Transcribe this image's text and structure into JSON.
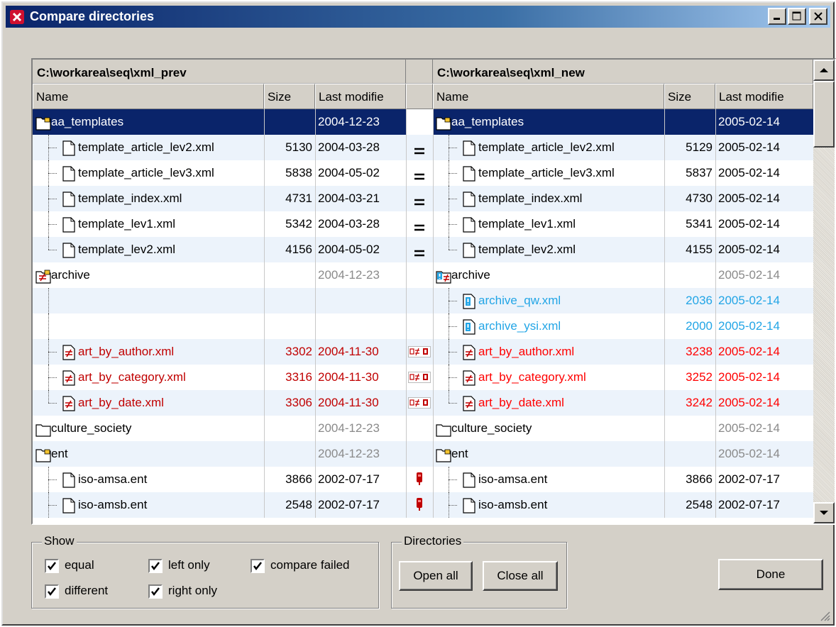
{
  "window": {
    "title": "Compare directories"
  },
  "left": {
    "path": "C:\\workarea\\seq\\xml_prev",
    "col_name": "Name",
    "col_size": "Size",
    "col_date": "Last modifie"
  },
  "right": {
    "path": "C:\\workarea\\seq\\xml_new",
    "col_name": "Name",
    "col_size": "Size",
    "col_date": "Last modifie"
  },
  "rows": [
    {
      "lname": "aa_templates",
      "lsize": "",
      "ldate": "2004-12-23",
      "mid": "",
      "rname": "aa_templates",
      "rsize": "",
      "rdate": "2005-02-14"
    },
    {
      "lname": "template_article_lev2.xml",
      "lsize": "5130",
      "ldate": "2004-03-28",
      "mid": "=",
      "rname": "template_article_lev2.xml",
      "rsize": "5129",
      "rdate": "2005-02-14"
    },
    {
      "lname": "template_article_lev3.xml",
      "lsize": "5838",
      "ldate": "2004-05-02",
      "mid": "=",
      "rname": "template_article_lev3.xml",
      "rsize": "5837",
      "rdate": "2005-02-14"
    },
    {
      "lname": "template_index.xml",
      "lsize": "4731",
      "ldate": "2004-03-21",
      "mid": "=",
      "rname": "template_index.xml",
      "rsize": "4730",
      "rdate": "2005-02-14"
    },
    {
      "lname": "template_lev1.xml",
      "lsize": "5342",
      "ldate": "2004-03-28",
      "mid": "=",
      "rname": "template_lev1.xml",
      "rsize": "5341",
      "rdate": "2005-02-14"
    },
    {
      "lname": "template_lev2.xml",
      "lsize": "4156",
      "ldate": "2004-05-02",
      "mid": "=",
      "rname": "template_lev2.xml",
      "rsize": "4155",
      "rdate": "2005-02-14"
    },
    {
      "lname": "archive",
      "lsize": "",
      "ldate": "2004-12-23",
      "mid": "",
      "rname": "archive",
      "rsize": "",
      "rdate": "2005-02-14"
    },
    {
      "lname": "",
      "lsize": "",
      "ldate": "",
      "mid": "",
      "rname": "archive_qw.xml",
      "rsize": "2036",
      "rdate": "2005-02-14"
    },
    {
      "lname": "",
      "lsize": "",
      "ldate": "",
      "mid": "",
      "rname": "archive_ysi.xml",
      "rsize": "2000",
      "rdate": "2005-02-14"
    },
    {
      "lname": "art_by_author.xml",
      "lsize": "3302",
      "ldate": "2004-11-30",
      "mid": "",
      "rname": "art_by_author.xml",
      "rsize": "3238",
      "rdate": "2005-02-14"
    },
    {
      "lname": "art_by_category.xml",
      "lsize": "3316",
      "ldate": "2004-11-30",
      "mid": "",
      "rname": "art_by_category.xml",
      "rsize": "3252",
      "rdate": "2005-02-14"
    },
    {
      "lname": "art_by_date.xml",
      "lsize": "3306",
      "ldate": "2004-11-30",
      "mid": "",
      "rname": "art_by_date.xml",
      "rsize": "3242",
      "rdate": "2005-02-14"
    },
    {
      "lname": "culture_society",
      "lsize": "",
      "ldate": "2004-12-23",
      "mid": "",
      "rname": "culture_society",
      "rsize": "",
      "rdate": "2005-02-14"
    },
    {
      "lname": "ent",
      "lsize": "",
      "ldate": "2004-12-23",
      "mid": "",
      "rname": "ent",
      "rsize": "",
      "rdate": "2005-02-14"
    },
    {
      "lname": "iso-amsa.ent",
      "lsize": "3866",
      "ldate": "2002-07-17",
      "mid": "",
      "rname": "iso-amsa.ent",
      "rsize": "3866",
      "rdate": "2002-07-17"
    },
    {
      "lname": "iso-amsb.ent",
      "lsize": "2548",
      "ldate": "2002-07-17",
      "mid": "",
      "rname": "iso-amsb.ent",
      "rsize": "2548",
      "rdate": "2002-07-17"
    }
  ],
  "show": {
    "title": "Show",
    "equal": "equal",
    "left_only": "left only",
    "compare_failed": "compare failed",
    "different": "different",
    "right_only": "right only"
  },
  "directories": {
    "title": "Directories",
    "open_all": "Open all",
    "close_all": "Close all"
  },
  "done": "Done",
  "colors": {
    "selection": "#0a246a",
    "different": "#c00000",
    "right_only": "#22a5e6"
  }
}
